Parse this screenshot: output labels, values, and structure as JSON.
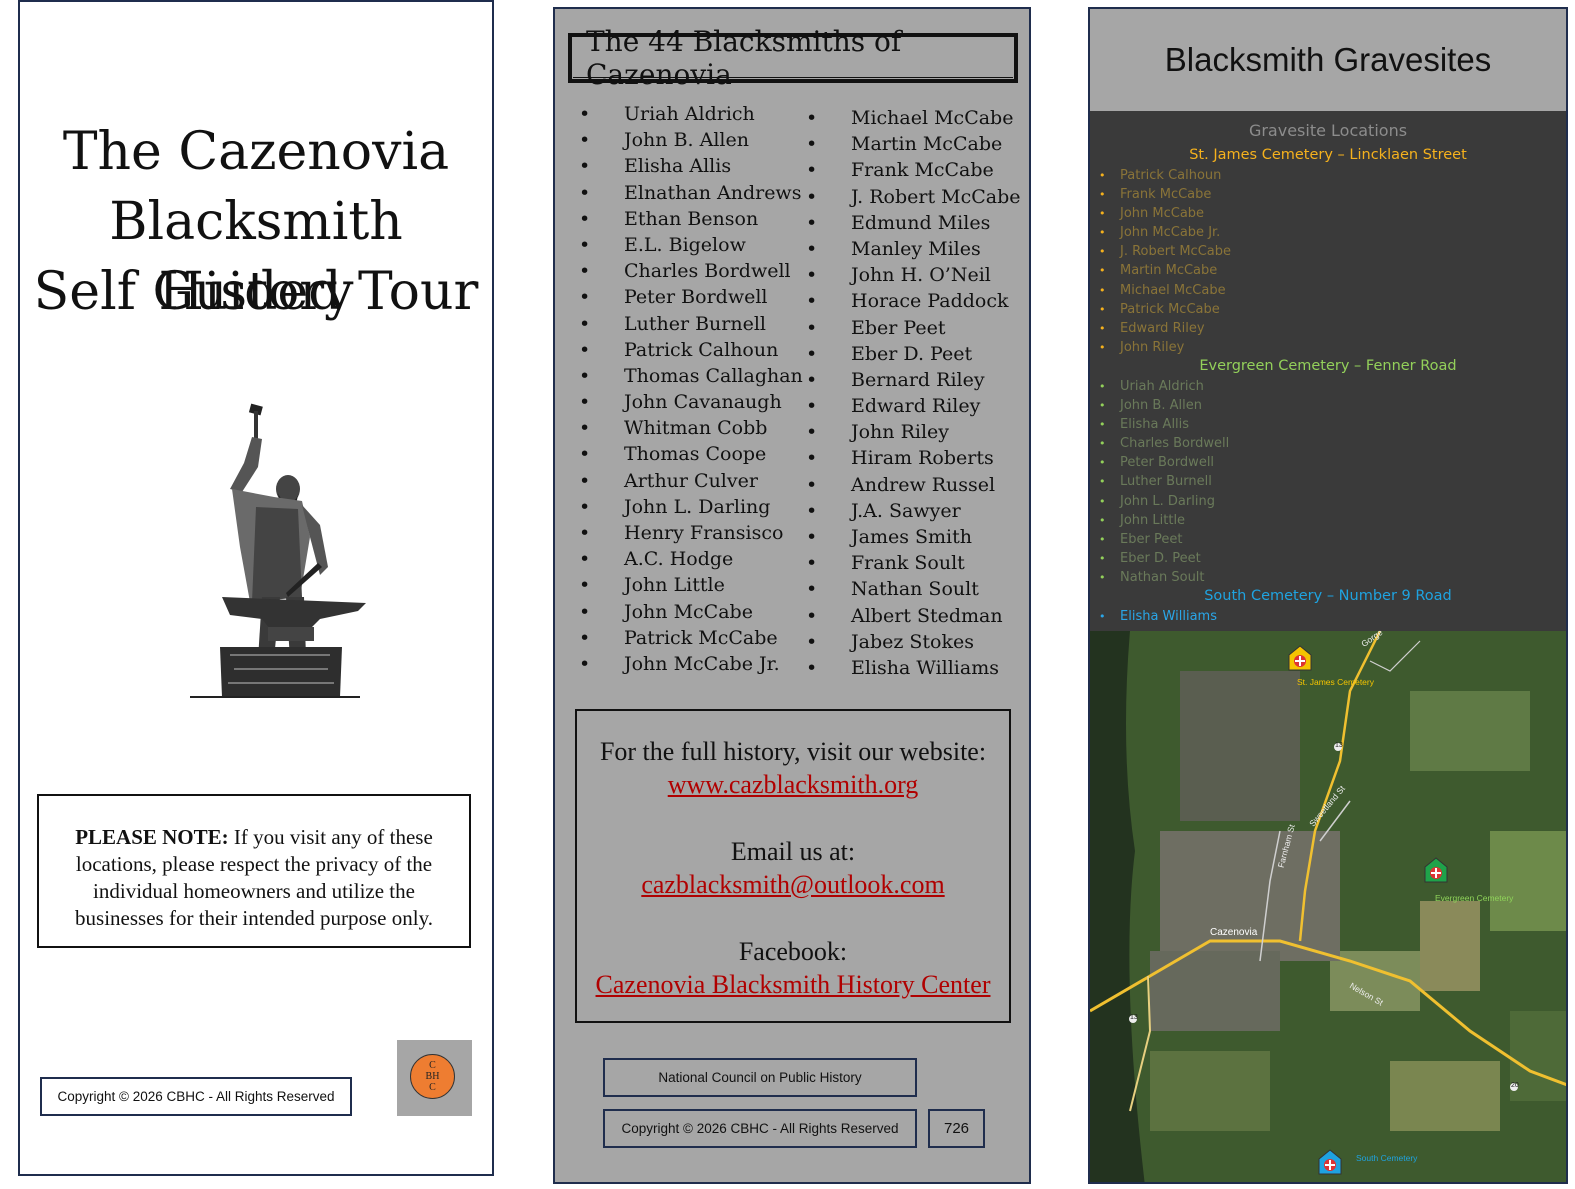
{
  "panel1": {
    "title_lines": [
      "The Cazenovia",
      "Blacksmith History",
      "Self Guided Tour"
    ],
    "note_bold": "PLEASE NOTE:",
    "note_text": " If you visit any of these locations, please respect the privacy of the individual homeowners and utilize the businesses for their intended purpose only.",
    "copyright": "Copyright © 2026 CBHC - All Rights Reserved",
    "logo_lines": [
      "C",
      "BH",
      "C"
    ]
  },
  "panel2": {
    "title": "The 44 Blacksmiths of Cazenovia",
    "column1": [
      "Uriah Aldrich",
      "John B. Allen",
      "Elisha Allis",
      "Elnathan Andrews",
      "Ethan Benson",
      "E.L. Bigelow",
      "Charles Bordwell",
      "Peter Bordwell",
      "Luther Burnell",
      "Patrick Calhoun",
      "Thomas Callaghan",
      "John Cavanaugh",
      "Whitman Cobb",
      "Thomas Coope",
      "Arthur Culver",
      "John L. Darling",
      "Henry Fransisco",
      "A.C. Hodge",
      "John Little",
      "John McCabe",
      "Patrick McCabe",
      "John McCabe Jr."
    ],
    "column2": [
      "Michael McCabe",
      "Martin McCabe",
      "Frank McCabe",
      "J. Robert McCabe",
      "Edmund Miles",
      "Manley Miles",
      "John H. O’Neil",
      "Horace Paddock",
      "Eber Peet",
      "Eber D. Peet",
      "Bernard Riley",
      "Edward Riley",
      "John Riley",
      "Hiram Roberts",
      "Andrew Russel",
      "J.A. Sawyer",
      "James Smith",
      "Frank Soult",
      "Nathan Soult",
      "Albert Stedman",
      "Jabez Stokes",
      "Elisha Williams"
    ],
    "website_label": "For the full history, visit our website:",
    "website": "www.cazblacksmith.org",
    "email_label": "Email us at:",
    "email": "cazblacksmith@outlook.com",
    "facebook_label": "Facebook:",
    "facebook": "Cazenovia Blacksmith History Center",
    "council": "National Council on Public History",
    "copyright": "Copyright © 2026 CBHC - All Rights Reserved",
    "page_number": "726"
  },
  "panel3": {
    "title": "Blacksmith Gravesites",
    "subtitle": "Gravesite Locations",
    "st_james": {
      "title": "St. James Cemetery – Lincklaen Street",
      "names": [
        "Patrick Calhoun",
        "Frank McCabe",
        "John McCabe",
        "John McCabe Jr.",
        "J. Robert McCabe",
        "Martin McCabe",
        "Michael McCabe",
        "Patrick McCabe",
        "Edward Riley",
        "John Riley"
      ]
    },
    "evergreen": {
      "title": "Evergreen Cemetery – Fenner Road",
      "names": [
        "Uriah Aldrich",
        "John B. Allen",
        "Elisha Allis",
        "Charles Bordwell",
        "Peter Bordwell",
        "Luther Burnell",
        "John L. Darling",
        "John Little",
        "Eber Peet",
        "Eber D. Peet",
        "Nathan Soult"
      ]
    },
    "south": {
      "title": "South Cemetery – Number 9 Road",
      "names": [
        "Elisha Williams"
      ]
    },
    "map": {
      "labels": {
        "st_james": "St. James Cemetery",
        "evergreen": "Evergreen Cemetery",
        "south": "South Cemetery",
        "town": "Cazenovia",
        "farnham": "Farnham St",
        "sweetland": "Sweetland St",
        "nelson": "Nelson St",
        "gorge": "Gorge",
        "r13a": "13",
        "r13b": "13",
        "r20": "20"
      },
      "colors": {
        "st_james": "#f5c400",
        "evergreen": "#1fa34a",
        "south": "#1fa3e0"
      }
    }
  }
}
